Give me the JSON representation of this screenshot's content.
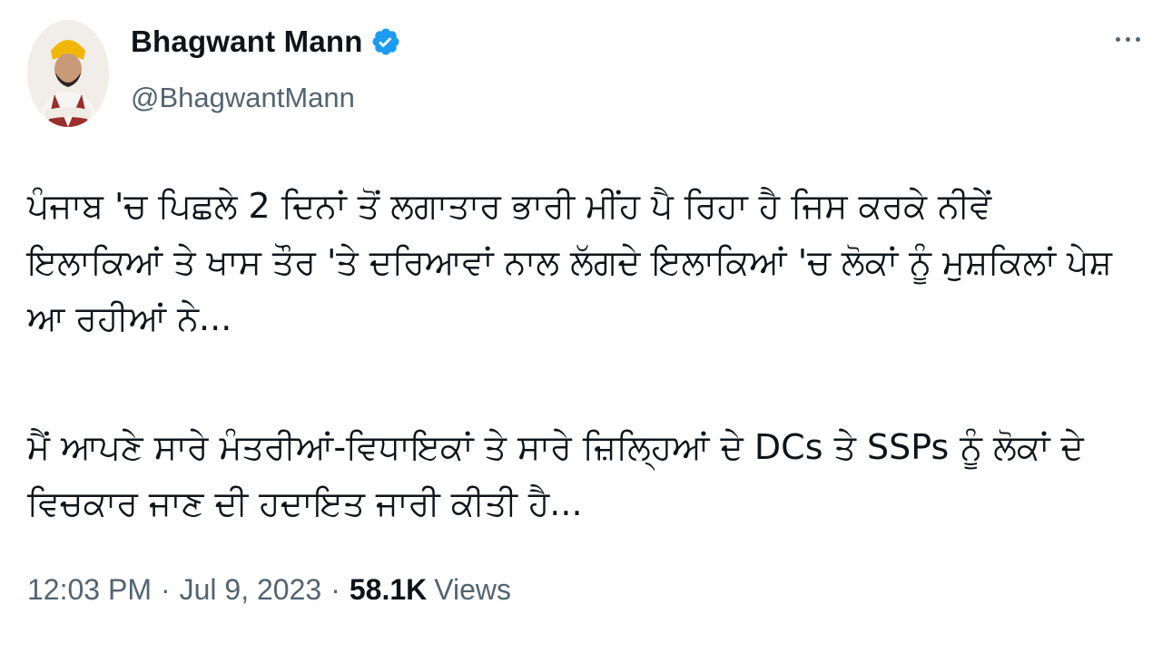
{
  "author": {
    "name": "Bhagwant Mann",
    "handle": "@BhagwantMann",
    "verified": true,
    "verified_color": "#1d9bf0"
  },
  "more_icon": "more-horizontal-icon",
  "tweet": {
    "paragraph_1": "ਪੰਜਾਬ 'ਚ ਪਿਛਲੇ 2 ਦਿਨਾਂ ਤੋਂ ਲਗਾਤਾਰ ਭਾਰੀ ਮੀਂਹ ਪੈ ਰਿਹਾ ਹੈ ਜਿਸ ਕਰਕੇ ਨੀਵੇਂ ਇਲਾਕਿਆਂ ਤੇ ਖਾਸ ਤੌਰ 'ਤੇ ਦਰਿਆਵਾਂ ਨਾਲ ਲੱਗਦੇ ਇਲਾਕਿਆਂ 'ਚ ਲੋਕਾਂ ਨੂੰ ਮੁਸ਼ਕਿਲਾਂ ਪੇਸ਼ ਆ ਰਹੀਆਂ ਨੇ...",
    "paragraph_2": "ਮੈਂ ਆਪਣੇ ਸਾਰੇ ਮੰਤਰੀਆਂ-ਵਿਧਾਇਕਾਂ ਤੇ ਸਾਰੇ ਜ਼ਿਲ੍ਹਿਆਂ ਦੇ DCs ਤੇ SSPs ਨੂੰ ਲੋਕਾਂ ਦੇ ਵਿਚਕਾਰ ਜਾਣ ਦੀ ਹਦਾਇਤ ਜਾਰੀ ਕੀਤੀ ਹੈ..."
  },
  "meta": {
    "time": "12:03 PM",
    "separator": "·",
    "date": "Jul 9, 2023",
    "views_count": "58.1K",
    "views_label": "Views"
  }
}
